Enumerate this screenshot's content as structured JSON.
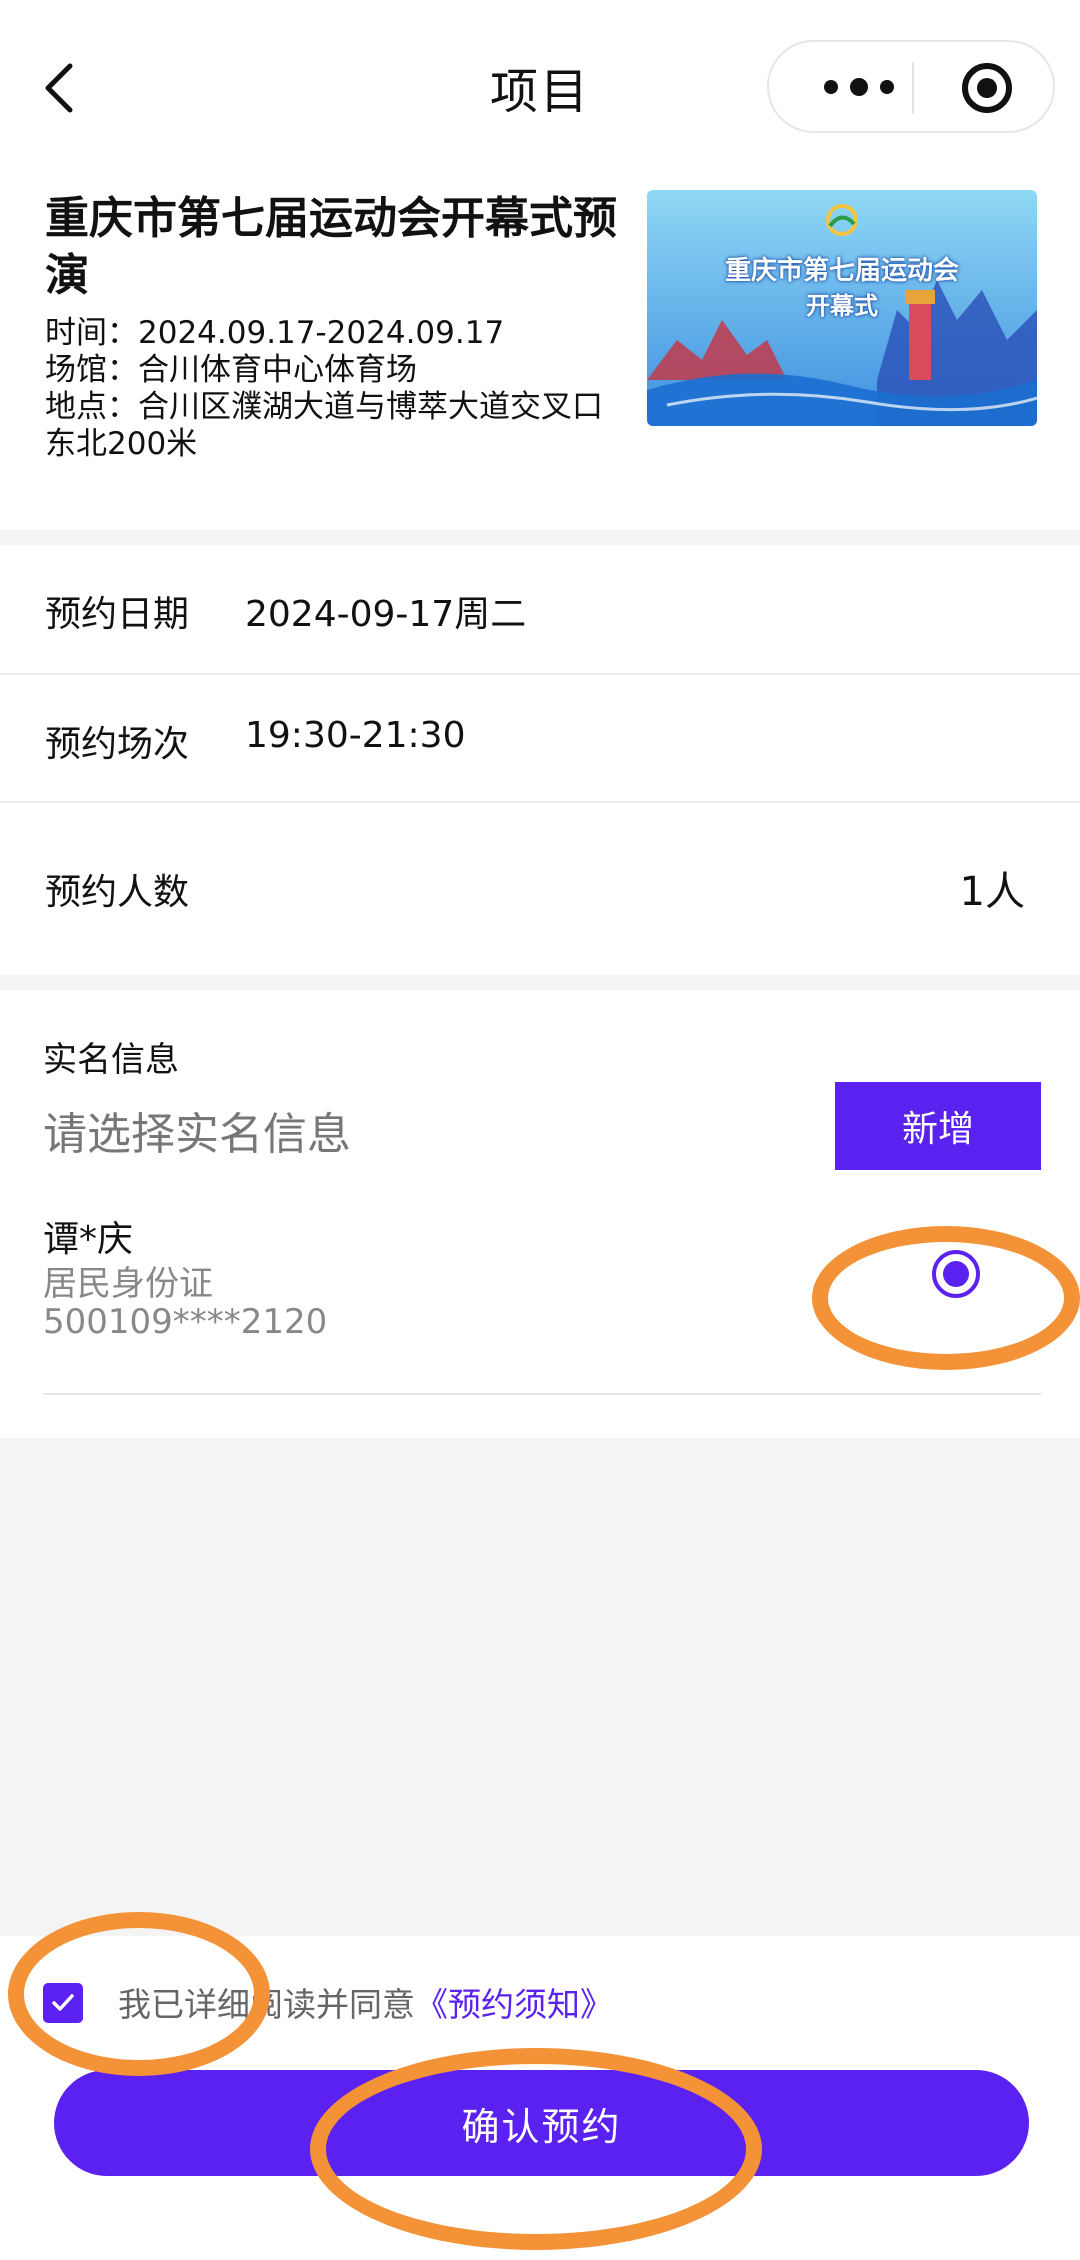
{
  "header": {
    "title": "项目"
  },
  "event": {
    "title": "重庆市第七届运动会开幕式预演",
    "time": "时间：2024.09.17-2024.09.17",
    "venue": "场馆：合川体育中心体育场",
    "address": "地点：合川区濮湖大道与博萃大道交叉口东北200米",
    "image_text_line1": "重庆市第七届运动会",
    "image_text_line2": "开幕式"
  },
  "booking": {
    "date_label": "预约日期",
    "date_value": "2024-09-17周二",
    "session_label": "预约场次",
    "session_value": "19:30-21:30",
    "count_label": "预约人数",
    "count_value": "1人"
  },
  "realname": {
    "section_title": "实名信息",
    "prompt": "请选择实名信息",
    "add_label": "新增",
    "person": {
      "name": "谭*庆",
      "id_type": "居民身份证",
      "id_number": "500109****2120",
      "selected": true
    }
  },
  "footer": {
    "agree_prefix": "我已详细阅读并同意",
    "agree_link": "《预约须知》",
    "agreed": true,
    "confirm_label": "确认预约"
  },
  "colors": {
    "accent": "#5a21f0",
    "annotation": "#f39237",
    "background": "#f4f4f4"
  }
}
